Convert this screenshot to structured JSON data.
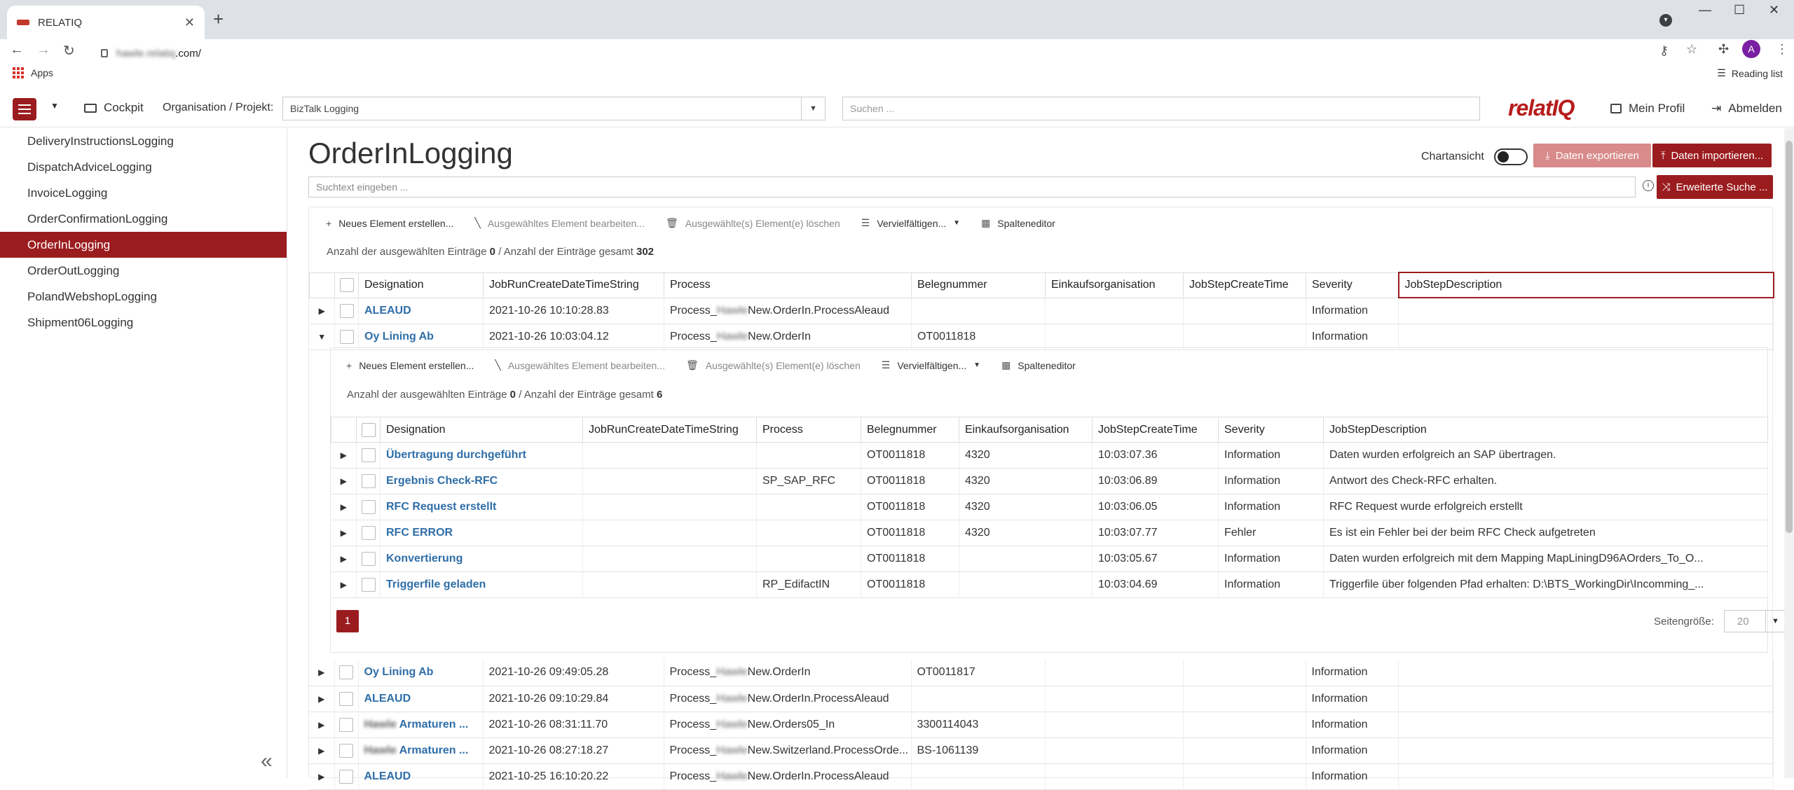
{
  "browser": {
    "tab_title": "RELATIQ",
    "url_blurred": "hawle.relatiq",
    "url_rest": ".com/",
    "apps_label": "Apps",
    "reading_list_label": "Reading list",
    "avatar_letter": "A"
  },
  "header": {
    "cockpit_label": "Cockpit",
    "org_label": "Organisation / Projekt:",
    "org_value": "BizTalk Logging",
    "search_placeholder": "Suchen ...",
    "logo_text": "relatIQ",
    "profile_label": "Mein Profil",
    "logout_label": "Abmelden"
  },
  "sidebar": {
    "items": [
      {
        "label": "DeliveryInstructionsLogging",
        "active": false
      },
      {
        "label": "DispatchAdviceLogging",
        "active": false
      },
      {
        "label": "InvoiceLogging",
        "active": false
      },
      {
        "label": "OrderConfirmationLogging",
        "active": false
      },
      {
        "label": "OrderInLogging",
        "active": true
      },
      {
        "label": "OrderOutLogging",
        "active": false
      },
      {
        "label": "PolandWebshopLogging",
        "active": false
      },
      {
        "label": "Shipment06Logging",
        "active": false
      }
    ],
    "collapse_glyph": "«"
  },
  "main": {
    "title": "OrderInLogging",
    "chart_toggle_label": "Chartansicht",
    "export_label": "Daten exportieren",
    "import_label": "Daten importieren...",
    "search_placeholder": "Suchtext eingeben ...",
    "advanced_search_label": "Erweiterte Suche ...",
    "actions": {
      "new": "Neues Element erstellen...",
      "edit": "Ausgewähltes Element bearbeiten...",
      "delete": "Ausgewählte(s) Element(e) löschen",
      "multiply": "Vervielfältigen...",
      "columns": "Spalteneditor"
    },
    "count_prefix": "Anzahl der ausgewählten Einträge",
    "count_selected": "0",
    "count_mid": "/ Anzahl der Einträge gesamt",
    "count_total": "302",
    "columns": [
      "Designation",
      "JobRunCreateDateTimeString",
      "Process",
      "Belegnummer",
      "Einkaufsorganisation",
      "JobStepCreateTime",
      "Severity",
      "JobStepDescription"
    ],
    "rows_top": [
      {
        "designation": "ALEAUD",
        "jobrun": "2021-10-26 10:10:28.83",
        "process_a": "Process_",
        "process_b": "Hawle",
        "process_c": "New.OrderIn.ProcessAleaud",
        "beleg": "",
        "einkauf": "",
        "jstime": "",
        "severity": "Information",
        "desc": "",
        "expanded": false
      },
      {
        "designation": "Oy Lining Ab",
        "jobrun": "2021-10-26 10:03:04.12",
        "process_a": "Process_",
        "process_b": "Hawle",
        "process_c": "New.OrderIn",
        "beleg": "OT0011818",
        "einkauf": "",
        "jstime": "",
        "severity": "Information",
        "desc": "",
        "expanded": true
      }
    ],
    "rows_bottom": [
      {
        "designation_a": "",
        "designation_b": "Oy Lining Ab",
        "jobrun": "2021-10-26 09:49:05.28",
        "process_a": "Process_",
        "process_b": "Hawle",
        "process_c": "New.OrderIn",
        "beleg": "OT0011817",
        "severity": "Information"
      },
      {
        "designation_a": "",
        "designation_b": "ALEAUD",
        "jobrun": "2021-10-26 09:10:29.84",
        "process_a": "Process_",
        "process_b": "Hawle",
        "process_c": "New.OrderIn.ProcessAleaud",
        "beleg": "",
        "severity": "Information"
      },
      {
        "designation_a": "Hawle",
        "designation_b": " Armaturen ...",
        "jobrun": "2021-10-26 08:31:11.70",
        "process_a": "Process_",
        "process_b": "Hawle",
        "process_c": "New.Orders05_In",
        "beleg": "3300114043",
        "severity": "Information"
      },
      {
        "designation_a": "Hawle",
        "designation_b": " Armaturen ...",
        "jobrun": "2021-10-26 08:27:18.27",
        "process_a": "Process_",
        "process_b": "Hawle",
        "process_c": "New.Switzerland.ProcessOrde...",
        "beleg": "BS-1061139",
        "severity": "Information"
      },
      {
        "designation_a": "",
        "designation_b": "ALEAUD",
        "jobrun": "2021-10-25 16:10:20.22",
        "process_a": "Process_",
        "process_b": "Hawle",
        "process_c": "New.OrderIn.ProcessAleaud",
        "beleg": "",
        "severity": "Information"
      }
    ]
  },
  "inner": {
    "count_prefix": "Anzahl der ausgewählten Einträge",
    "count_selected": "0",
    "count_mid": "/ Anzahl der Einträge gesamt",
    "count_total": "6",
    "rows": [
      {
        "designation": "Übertragung durchgeführt",
        "jobrun": "",
        "process": "",
        "beleg": "OT0011818",
        "einkauf": "4320",
        "jstime": "10:03:07.36",
        "severity": "Information",
        "desc": "Daten wurden erfolgreich an SAP übertragen."
      },
      {
        "designation": "Ergebnis Check-RFC",
        "jobrun": "",
        "process": "SP_SAP_RFC",
        "beleg": "OT0011818",
        "einkauf": "4320",
        "jstime": "10:03:06.89",
        "severity": "Information",
        "desc": "Antwort des Check-RFC erhalten."
      },
      {
        "designation": "RFC Request erstellt",
        "jobrun": "",
        "process": "",
        "beleg": "OT0011818",
        "einkauf": "4320",
        "jstime": "10:03:06.05",
        "severity": "Information",
        "desc": "RFC Request wurde erfolgreich erstellt"
      },
      {
        "designation": "RFC ERROR",
        "jobrun": "",
        "process": "",
        "beleg": "OT0011818",
        "einkauf": "4320",
        "jstime": "10:03:07.77",
        "severity": "Fehler",
        "desc": "Es ist ein Fehler bei der beim RFC Check aufgetreten"
      },
      {
        "designation": "Konvertierung",
        "jobrun": "",
        "process": "",
        "beleg": "OT0011818",
        "einkauf": "",
        "jstime": "10:03:05.67",
        "severity": "Information",
        "desc": "Daten wurden erfolgreich mit dem Mapping MapLiningD96AOrders_To_O..."
      },
      {
        "designation": "Triggerfile geladen",
        "jobrun": "",
        "process": "RP_EdifactIN",
        "beleg": "OT0011818",
        "einkauf": "",
        "jstime": "10:03:04.69",
        "severity": "Information",
        "desc": "Triggerfile über folgenden Pfad erhalten: D:\\BTS_WorkingDir\\Incomming_..."
      }
    ],
    "current_page": "1",
    "page_size_label": "Seitengröße:",
    "page_size_value": "20"
  },
  "colors": {
    "brand": "#9b1c1f",
    "link": "#2f6ea8"
  }
}
